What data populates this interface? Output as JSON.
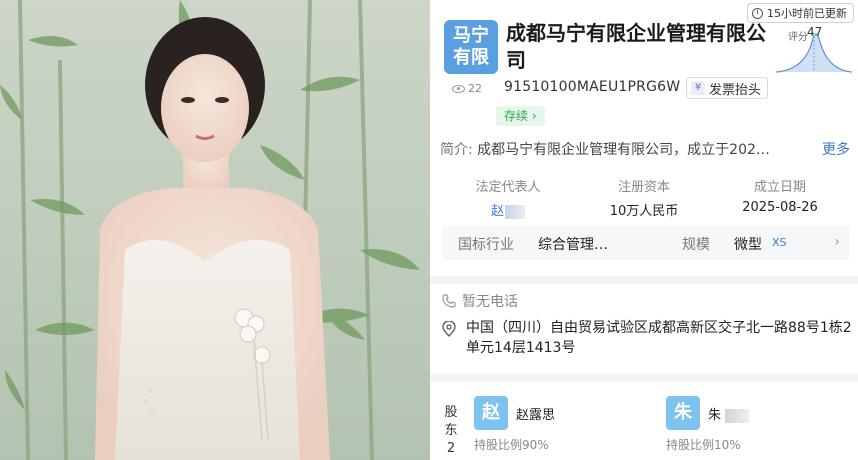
{
  "photo": {
    "description_icon": "portrait-photo"
  },
  "header": {
    "update_text": "15小时前已更新",
    "logo_line1": "马宁",
    "logo_line2": "有限",
    "company_name": "成都马宁有限企业管理有限公司",
    "score_label": "评分",
    "score_value": "47",
    "views": "22",
    "credit_code": "91510100MAEU1PRG6W",
    "invoice_label": "发票抬头",
    "invoice_icon": "¥",
    "status": "存续",
    "status_arrow": "›"
  },
  "intro": {
    "label": "简介:",
    "text": "成都马宁有限企业管理有限公司，成立于202…",
    "more": "更多"
  },
  "stats": {
    "legal_rep_title": "法定代表人",
    "legal_rep_value": "赵",
    "capital_title": "注册资本",
    "capital_value": "10万人民币",
    "founded_title": "成立日期",
    "founded_value": "2025-08-26"
  },
  "industry": {
    "industry_key": "国标行业",
    "industry_value": "综合管理…",
    "scale_key": "规模",
    "scale_value": "微型",
    "scale_tag": "XS",
    "chevron": "›"
  },
  "contact": {
    "phone": "暂无电话",
    "address": "中国（四川）自由贸易试验区成都高新区交子北一路88号1栋2单元14层1413号"
  },
  "shareholders": {
    "label_line1": "股",
    "label_line2": "东",
    "count": "2",
    "items": [
      {
        "avatar": "赵",
        "name": "赵露思",
        "ratio": "持股比例90%"
      },
      {
        "avatar": "朱",
        "name": "朱",
        "ratio": "持股比例10%"
      }
    ]
  },
  "colors": {
    "accent": "#3a7bd5",
    "status_green": "#2eaa55",
    "logo_blue": "#5a9fe0",
    "avatar_blue": "#7cc3f0"
  }
}
